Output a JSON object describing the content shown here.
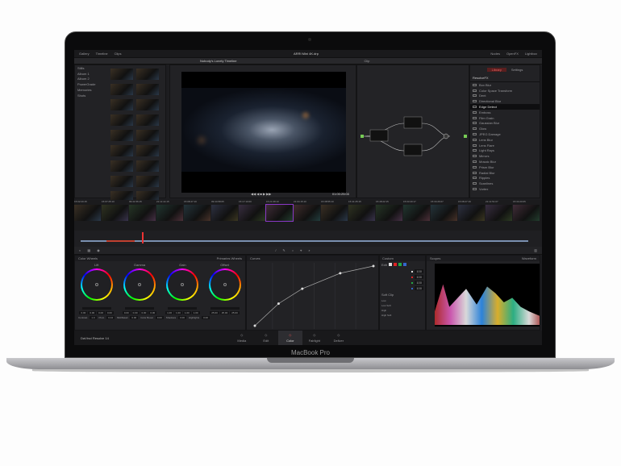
{
  "device": {
    "label": "MacBook Pro"
  },
  "top_bar": {
    "left": [
      "Gallery",
      "Timeline",
      "Clips"
    ],
    "title": "ARRI Mini 4K.drp",
    "right": [
      "Nodes",
      "OpenFX",
      "Lightbox"
    ]
  },
  "viewer": {
    "title": "Nobody's Lonely Timeline",
    "timecode": "01:00:25:00",
    "zoom": "Clip"
  },
  "media_pool": {
    "albums": [
      "Stills",
      "Album 1",
      "Album 2",
      "PowerGrade",
      "Memories",
      "Shots"
    ]
  },
  "openfx": {
    "tabs": [
      "Library",
      "Settings"
    ],
    "header": "ResolveFX",
    "selected": 4,
    "items": [
      "Box Blur",
      "Color Space Transform",
      "Dent",
      "Directional Blur",
      "Edge Detect",
      "Emboss",
      "Film Grain",
      "Gaussian Blur",
      "Glow",
      "JPEG Damage",
      "Lens Blur",
      "Lens Flare",
      "Light Rays",
      "Mirrors",
      "Mosaic Blur",
      "Prism Blur",
      "Radial Blur",
      "Ripples",
      "Scanlines",
      "Vortex"
    ]
  },
  "clips": {
    "timecodes": [
      "15:02:20:15",
      "15:07:25:10",
      "09:41:56:15",
      "21:11:14:15",
      "15:08:47:10",
      "09:44:58:05",
      "15:17:10:00",
      "15:21:08:10",
      "21:04:15:10",
      "15:38:55:10",
      "15:41:25:15",
      "15:48:22:15",
      "15:03:40:17",
      "15:34:26:07",
      "15:08:27:19",
      "21:11:51:07",
      "15:34:20:05"
    ],
    "selected": 7
  },
  "color_wheels": {
    "title": "Color Wheels",
    "mode": "Primaries Wheels",
    "wheels": [
      {
        "name": "Lift",
        "values": [
          "0.00",
          "0.00",
          "0.00",
          "0.00"
        ]
      },
      {
        "name": "Gamma",
        "values": [
          "0.00",
          "0.00",
          "0.00",
          "0.00"
        ]
      },
      {
        "name": "Gain",
        "values": [
          "1.00",
          "1.00",
          "1.00",
          "1.00"
        ]
      },
      {
        "name": "Offset",
        "values": [
          "25.00",
          "25.00",
          "25.00"
        ]
      }
    ],
    "params": [
      {
        "label": "Contrast",
        "value": "1.0"
      },
      {
        "label": "Pivot",
        "value": "0.44"
      },
      {
        "label": "Mid/Detail",
        "value": "0.00"
      },
      {
        "label": "Color Boost",
        "value": "0.00"
      },
      {
        "label": "Shadows",
        "value": "0.00"
      },
      {
        "label": "Highlights",
        "value": "0.00"
      }
    ]
  },
  "curves": {
    "title": "Curves",
    "mode": "Custom",
    "points": [
      [
        0,
        0
      ],
      [
        0.2,
        0.37
      ],
      [
        0.4,
        0.62
      ],
      [
        0.72,
        0.88
      ],
      [
        1,
        1
      ]
    ]
  },
  "custom": {
    "edit": "Edit",
    "values": [
      "100",
      "100",
      "100",
      "100"
    ],
    "soft_clip": "Soft Clip",
    "sliders": [
      "Low",
      "Low Soft",
      "High",
      "High Soft"
    ]
  },
  "scopes": {
    "title": "Scopes",
    "mode": "Waveform"
  },
  "app": {
    "name": "DaVinci Resolve 14"
  },
  "pages": [
    {
      "label": "Media"
    },
    {
      "label": "Edit"
    },
    {
      "label": "Color",
      "active": true
    },
    {
      "label": "Fairlight"
    },
    {
      "label": "Deliver"
    }
  ]
}
